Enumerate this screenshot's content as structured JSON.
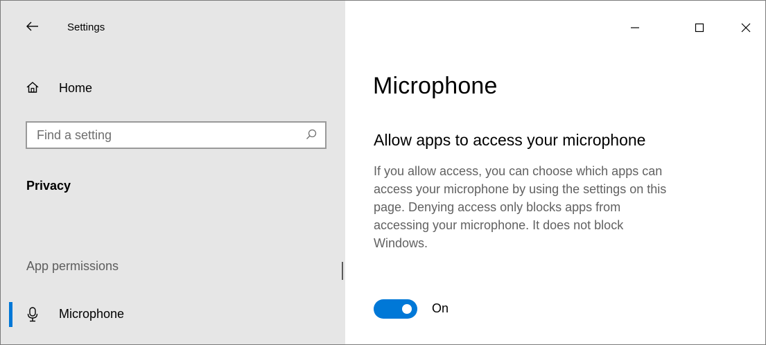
{
  "window": {
    "title": "Settings",
    "controls": {
      "minimize": "minimize-icon",
      "maximize": "maximize-icon",
      "close": "close-icon"
    }
  },
  "sidebar": {
    "back_icon": "back-arrow-icon",
    "home": {
      "label": "Home",
      "icon": "home-icon"
    },
    "search": {
      "placeholder": "Find a setting",
      "value": "",
      "icon": "search-icon"
    },
    "section_title": "Privacy",
    "group_header": "App permissions",
    "items": [
      {
        "label": "Microphone",
        "icon": "microphone-icon",
        "selected": true
      }
    ]
  },
  "content": {
    "page_title": "Microphone",
    "heading": "Allow apps to access your microphone",
    "description_lines": [
      "If you allow access, you can choose which apps can",
      "access your microphone by using the settings on this",
      "page. Denying access only blocks apps from",
      "accessing your microphone. It does not block",
      "Windows."
    ],
    "toggle": {
      "state": true,
      "label": "On"
    }
  },
  "colors": {
    "accent": "#0078d7",
    "sidebar_bg": "#e6e6e6",
    "content_bg": "#ffffff",
    "secondary_text": "#616161"
  }
}
